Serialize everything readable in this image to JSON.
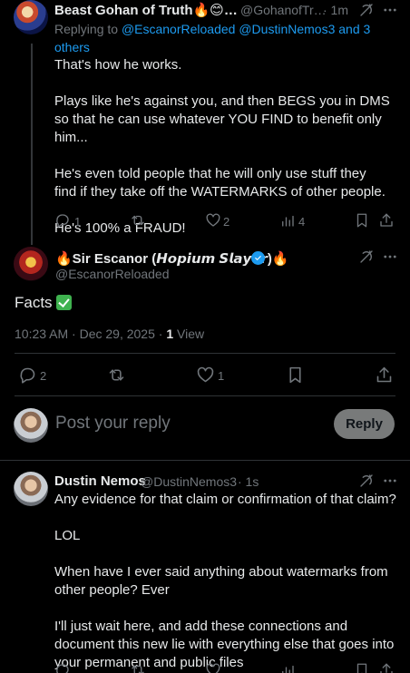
{
  "tweet1": {
    "author_name": "Beast Gohan of Truth🔥😊…",
    "handle": "@GohanofTr…",
    "time": "· 1m",
    "replying_prefix": "Replying to ",
    "replying_to": "@EscanorReloaded @DustinNemos3 and 3 others",
    "body": "That's how he works.\n\nPlays like he's against you, and then BEGS you in DMS so that he can use whatever YOU FIND to benefit only him...\n\nHe's even told people that he will only use stuff they find if they take off the WATERMARKS of other people.\n\nHe's 100% a FRAUD!",
    "replies": "1",
    "likes": "2",
    "views": "4"
  },
  "main_tweet": {
    "author_name": "🔥Sir Escanor (𝙃𝙤𝙥𝙞𝙪𝙢 𝙎𝙡𝙖𝙮𝙚𝙧)🔥",
    "handle": "@EscanorReloaded",
    "body": "Facts",
    "timestamp": "10:23 AM · Dec 29, 2025 · ",
    "view_count": "1",
    "view_label": "View",
    "replies": "2",
    "likes": "1"
  },
  "composer": {
    "placeholder": "Post your reply",
    "reply_button": "Reply"
  },
  "tweet3": {
    "author_name": "Dustin Nemos",
    "handle": "@DustinNemos3",
    "time": "· 1s",
    "body": "Any evidence for that claim or confirmation of that claim?\n\nLOL\n\nWhen have I ever said anything about watermarks from other people? Ever\n\nI'll just wait here, and add these connections and document this new lie with everything else that goes into your permanent and public files"
  },
  "icons": [
    "grok-icon",
    "more-icon",
    "reply-icon",
    "repost-icon",
    "like-icon",
    "views-icon",
    "bookmark-icon",
    "share-icon",
    "verified-icon"
  ],
  "colors": {
    "accent": "#1d9bf0",
    "muted": "#71767b",
    "reply_button_bg": "#787a7a"
  }
}
